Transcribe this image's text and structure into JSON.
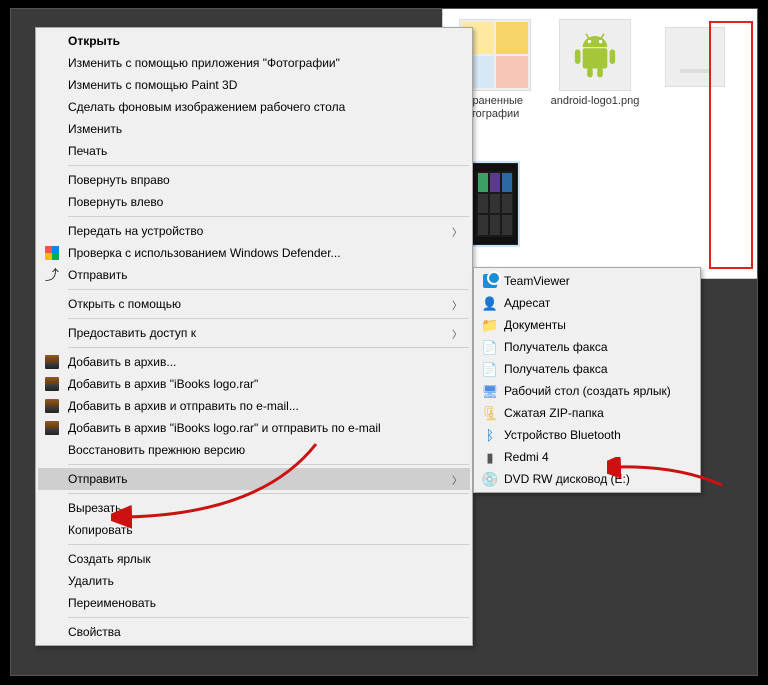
{
  "files": [
    {
      "label": "храненные тографии",
      "kind": "folder-collage"
    },
    {
      "label": "android-logo1.png",
      "kind": "android"
    },
    {
      "label": "",
      "kind": "webpage"
    },
    {
      "label": "",
      "kind": "phone-dark"
    }
  ],
  "menu": [
    {
      "label": "Открыть",
      "bold": true
    },
    {
      "label": "Изменить с помощью приложения \"Фотографии\""
    },
    {
      "label": "Изменить с помощью Paint 3D"
    },
    {
      "label": "Сделать фоновым изображением рабочего стола"
    },
    {
      "label": "Изменить"
    },
    {
      "label": "Печать"
    },
    {
      "sep": true
    },
    {
      "label": "Повернуть вправо"
    },
    {
      "label": "Повернуть влево"
    },
    {
      "sep": true
    },
    {
      "label": "Передать на устройство",
      "arrow": true
    },
    {
      "label": "Проверка с использованием Windows Defender...",
      "icon": "defender"
    },
    {
      "label": "Отправить",
      "icon": "share"
    },
    {
      "sep": true
    },
    {
      "label": "Открыть с помощью",
      "arrow": true
    },
    {
      "sep": true
    },
    {
      "label": "Предоставить доступ к",
      "arrow": true
    },
    {
      "sep": true
    },
    {
      "label": "Добавить в архив...",
      "icon": "winrar"
    },
    {
      "label": "Добавить в архив \"iBooks logo.rar\"",
      "icon": "winrar"
    },
    {
      "label": "Добавить в архив и отправить по e-mail...",
      "icon": "winrar"
    },
    {
      "label": "Добавить в архив \"iBooks logo.rar\" и отправить по e-mail",
      "icon": "winrar"
    },
    {
      "label": "Восстановить прежнюю версию"
    },
    {
      "sep": true
    },
    {
      "label": "Отправить",
      "arrow": true,
      "highlight": true
    },
    {
      "sep": true
    },
    {
      "label": "Вырезать"
    },
    {
      "label": "Копировать"
    },
    {
      "sep": true
    },
    {
      "label": "Создать ярлык"
    },
    {
      "label": "Удалить"
    },
    {
      "label": "Переименовать"
    },
    {
      "sep": true
    },
    {
      "label": "Свойства"
    }
  ],
  "submenu": [
    {
      "label": "TeamViewer",
      "icon": "tv"
    },
    {
      "label": "Адресат",
      "icon": "addr"
    },
    {
      "label": "Документы",
      "icon": "folder"
    },
    {
      "label": "Получатель факса",
      "icon": "doc"
    },
    {
      "label": "Получатель факса",
      "icon": "doc"
    },
    {
      "label": "Рабочий стол (создать ярлык)",
      "icon": "desktop"
    },
    {
      "label": "Сжатая ZIP-папка",
      "icon": "zip"
    },
    {
      "label": "Устройство Bluetooth",
      "icon": "bt"
    },
    {
      "label": "Redmi 4",
      "icon": "phone"
    },
    {
      "label": "DVD RW дисковод (E:)",
      "icon": "disc"
    }
  ]
}
